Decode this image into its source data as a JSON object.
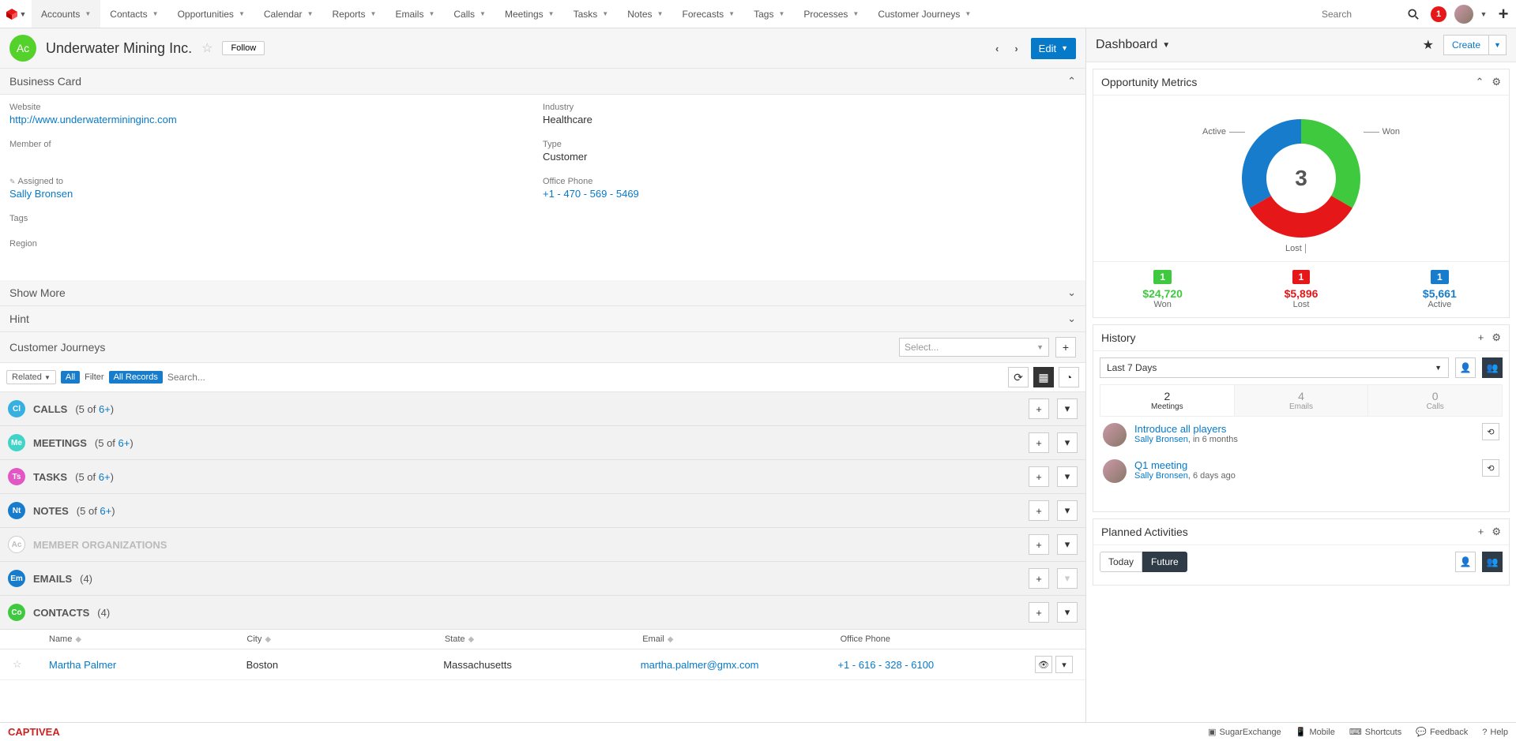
{
  "nav": {
    "items": [
      "Accounts",
      "Contacts",
      "Opportunities",
      "Calendar",
      "Reports",
      "Emails",
      "Calls",
      "Meetings",
      "Tasks",
      "Notes",
      "Forecasts",
      "Tags",
      "Processes",
      "Customer Journeys"
    ],
    "active": "Accounts",
    "search_placeholder": "Search",
    "notif_count": "1"
  },
  "record": {
    "avatar": "Ac",
    "title": "Underwater Mining Inc.",
    "follow": "Follow",
    "edit": "Edit"
  },
  "business_card": {
    "title": "Business Card",
    "fields": {
      "website_label": "Website",
      "website_value": "http://www.underwatermininginc.com",
      "industry_label": "Industry",
      "industry_value": "Healthcare",
      "member_label": "Member of",
      "member_value": "",
      "type_label": "Type",
      "type_value": "Customer",
      "assigned_label": "Assigned to",
      "assigned_value": "Sally Bronsen",
      "phone_label": "Office Phone",
      "phone_value": "+1 - 470 - 569 - 5469",
      "tags_label": "Tags",
      "region_label": "Region"
    }
  },
  "panels": {
    "show_more": "Show More",
    "hint": "Hint",
    "customer_journeys": "Customer Journeys",
    "cj_placeholder": "Select..."
  },
  "filter": {
    "related": "Related",
    "all": "All",
    "filter_lbl": "Filter",
    "all_records": "All Records",
    "search_placeholder": "Search..."
  },
  "subpanels": [
    {
      "icon": "Cl",
      "color": "#36b0e0",
      "title": "CALLS",
      "count": "(5 of ",
      "countlink": "6+",
      "countend": ")"
    },
    {
      "icon": "Me",
      "color": "#3fd4c7",
      "title": "MEETINGS",
      "count": "(5 of ",
      "countlink": "6+",
      "countend": ")"
    },
    {
      "icon": "Ts",
      "color": "#e256c5",
      "title": "TASKS",
      "count": "(5 of ",
      "countlink": "6+",
      "countend": ")"
    },
    {
      "icon": "Nt",
      "color": "#167ccb",
      "title": "NOTES",
      "count": "(5 of ",
      "countlink": "6+",
      "countend": ")"
    },
    {
      "icon": "Ac",
      "color": "disabled",
      "title": "MEMBER ORGANIZATIONS",
      "count": "",
      "countlink": "",
      "countend": ""
    },
    {
      "icon": "Em",
      "color": "#167ccb",
      "title": "EMAILS",
      "count": "(4)",
      "countlink": "",
      "countend": ""
    },
    {
      "icon": "Co",
      "color": "#3fc93f",
      "title": "CONTACTS",
      "count": "(4)",
      "countlink": "",
      "countend": ""
    }
  ],
  "contacts_table": {
    "headers": {
      "name": "Name",
      "city": "City",
      "state": "State",
      "email": "Email",
      "phone": "Office Phone"
    },
    "rows": [
      {
        "name": "Martha Palmer",
        "city": "Boston",
        "state": "Massachusetts",
        "email": "martha.palmer@gmx.com",
        "phone": "+1 - 616 - 328 - 6100"
      }
    ]
  },
  "dashboard": {
    "title": "Dashboard",
    "create": "Create"
  },
  "opp_metrics": {
    "title": "Opportunity Metrics",
    "center": "3",
    "labels": {
      "won": "Won",
      "lost": "Lost",
      "active": "Active"
    },
    "stats": [
      {
        "badge": "1",
        "amount": "$24,720",
        "label": "Won",
        "cls": "green"
      },
      {
        "badge": "1",
        "amount": "$5,896",
        "label": "Lost",
        "cls": "red"
      },
      {
        "badge": "1",
        "amount": "$5,661",
        "label": "Active",
        "cls": "blue"
      }
    ]
  },
  "history": {
    "title": "History",
    "range": "Last 7 Days",
    "tabs": [
      {
        "num": "2",
        "lbl": "Meetings",
        "active": true
      },
      {
        "num": "4",
        "lbl": "Emails",
        "active": false
      },
      {
        "num": "0",
        "lbl": "Calls",
        "active": false
      }
    ],
    "items": [
      {
        "title": "Introduce all players",
        "user": "Sally Bronsen",
        "when": ", in 6 months"
      },
      {
        "title": "Q1 meeting",
        "user": "Sally Bronsen",
        "when": ", 6 days ago"
      }
    ]
  },
  "planned": {
    "title": "Planned Activities",
    "today": "Today",
    "future": "Future"
  },
  "footer": {
    "brand": "CAPTIVEA",
    "items": [
      "SugarExchange",
      "Mobile",
      "Shortcuts",
      "Feedback",
      "Help"
    ]
  },
  "chart_data": {
    "type": "pie",
    "title": "Opportunity Metrics",
    "series": [
      {
        "name": "Won",
        "value": 1,
        "amount": 24720,
        "color": "#3fc93f"
      },
      {
        "name": "Lost",
        "value": 1,
        "amount": 5896,
        "color": "#e61718"
      },
      {
        "name": "Active",
        "value": 1,
        "amount": 5661,
        "color": "#167ccb"
      }
    ],
    "total": 3
  }
}
